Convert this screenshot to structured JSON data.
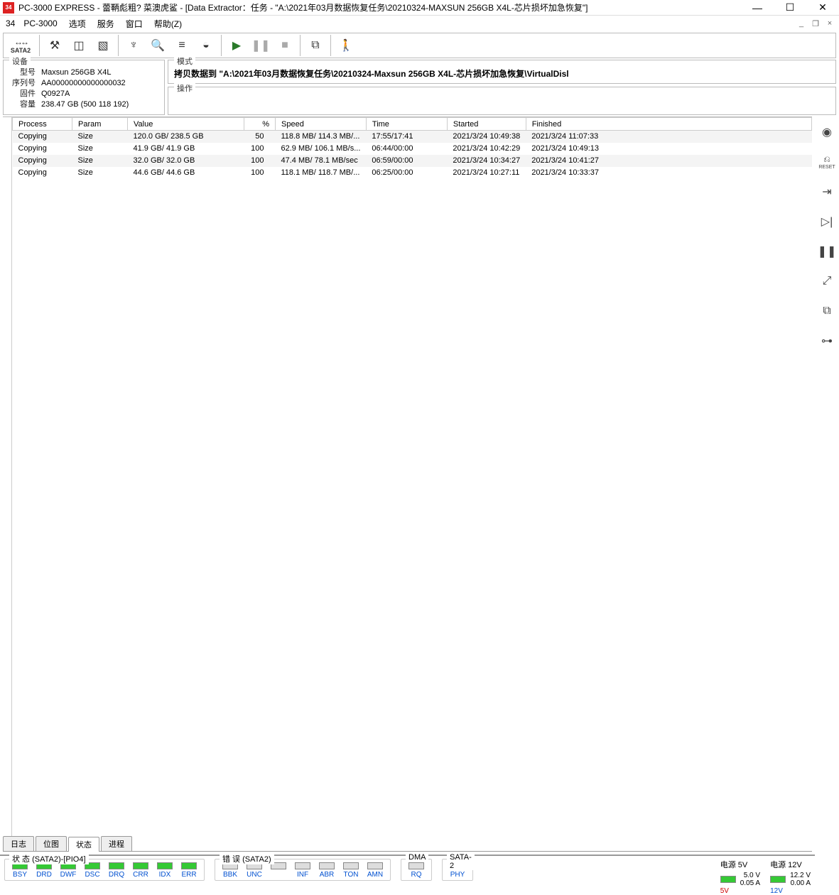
{
  "title": "PC-3000 EXPRESS - 蕾鞆彪粗? 菜澳虎鲨      - [Data Extractor：任务  -  \"A:\\2021年03月数据恢复任务\\20210324-MAXSUN  256GB X4L-芯片损坏加急恢复\"]",
  "menu": {
    "pc3000": "PC-3000",
    "options": "选项",
    "service": "服务",
    "window": "窗口",
    "help": "帮助(Z)"
  },
  "sata_label": "SATA2",
  "device_panel": {
    "legend": "设备",
    "model_lbl": "型号",
    "model": "Maxsun  256GB X4L",
    "serial_lbl": "序列号",
    "serial": "AA00000000000000032",
    "firmware_lbl": "固件",
    "firmware": "Q0927A",
    "capacity_lbl": "容量",
    "capacity": "238.47 GB (500 118 192)"
  },
  "mode_panel": {
    "legend": "模式",
    "text": "拷贝数据到 \"A:\\2021年03月数据恢复任务\\20210324-Maxsun  256GB X4L-芯片损坏加急恢复\\VirtualDisl"
  },
  "op_panel": {
    "legend": "操作"
  },
  "columns": {
    "process": "Process",
    "param": "Param",
    "value": "Value",
    "pct": "%",
    "speed": "Speed",
    "time": "Time",
    "started": "Started",
    "finished": "Finished"
  },
  "rows": [
    {
      "process": "Copying",
      "param": "Size",
      "value": "120.0 GB/ 238.5 GB",
      "pct": "50",
      "speed": "118.8 MB/ 114.3 MB/...",
      "time": "17:55/17:41",
      "started": "2021/3/24 10:49:38",
      "finished": "2021/3/24 11:07:33"
    },
    {
      "process": "Copying",
      "param": "Size",
      "value": "41.9 GB/ 41.9 GB",
      "pct": "100",
      "speed": "62.9 MB/ 106.1 MB/s...",
      "time": "06:44/00:00",
      "started": "2021/3/24 10:42:29",
      "finished": "2021/3/24 10:49:13"
    },
    {
      "process": "Copying",
      "param": "Size",
      "value": "32.0 GB/ 32.0 GB",
      "pct": "100",
      "speed": "47.4 MB/ 78.1 MB/sec",
      "time": "06:59/00:00",
      "started": "2021/3/24 10:34:27",
      "finished": "2021/3/24 10:41:27"
    },
    {
      "process": "Copying",
      "param": "Size",
      "value": "44.6 GB/ 44.6 GB",
      "pct": "100",
      "speed": "118.1 MB/ 118.7 MB/...",
      "time": "06:25/00:00",
      "started": "2021/3/24 10:27:11",
      "finished": "2021/3/24 10:33:37"
    }
  ],
  "tabs": {
    "log": "日志",
    "bitmap": "位图",
    "status": "状态",
    "progress": "进程"
  },
  "sidebar_reset": "RESET",
  "status_groups": {
    "state": {
      "legend": "状 态 (SATA2)-[PIO4]",
      "inds": [
        "BSY",
        "DRD",
        "DWF",
        "DSC",
        "DRQ",
        "CRR",
        "IDX",
        "ERR"
      ]
    },
    "error": {
      "legend": "错 误 (SATA2)",
      "inds": [
        "BBK",
        "UNC",
        "",
        "INF",
        "ABR",
        "TON",
        "AMN"
      ]
    },
    "dma": {
      "legend": "DMA",
      "inds": [
        "RQ"
      ]
    },
    "sata": {
      "legend": "SATA-2",
      "inds": [
        "PHY"
      ]
    }
  },
  "power": {
    "p5": {
      "legend": "电源 5V",
      "lbl": "5V",
      "v": "5.0 V",
      "a": "0.05 A"
    },
    "p12": {
      "legend": "电源 12V",
      "lbl": "12V",
      "v": "12.2 V",
      "a": "0.00 A"
    }
  }
}
